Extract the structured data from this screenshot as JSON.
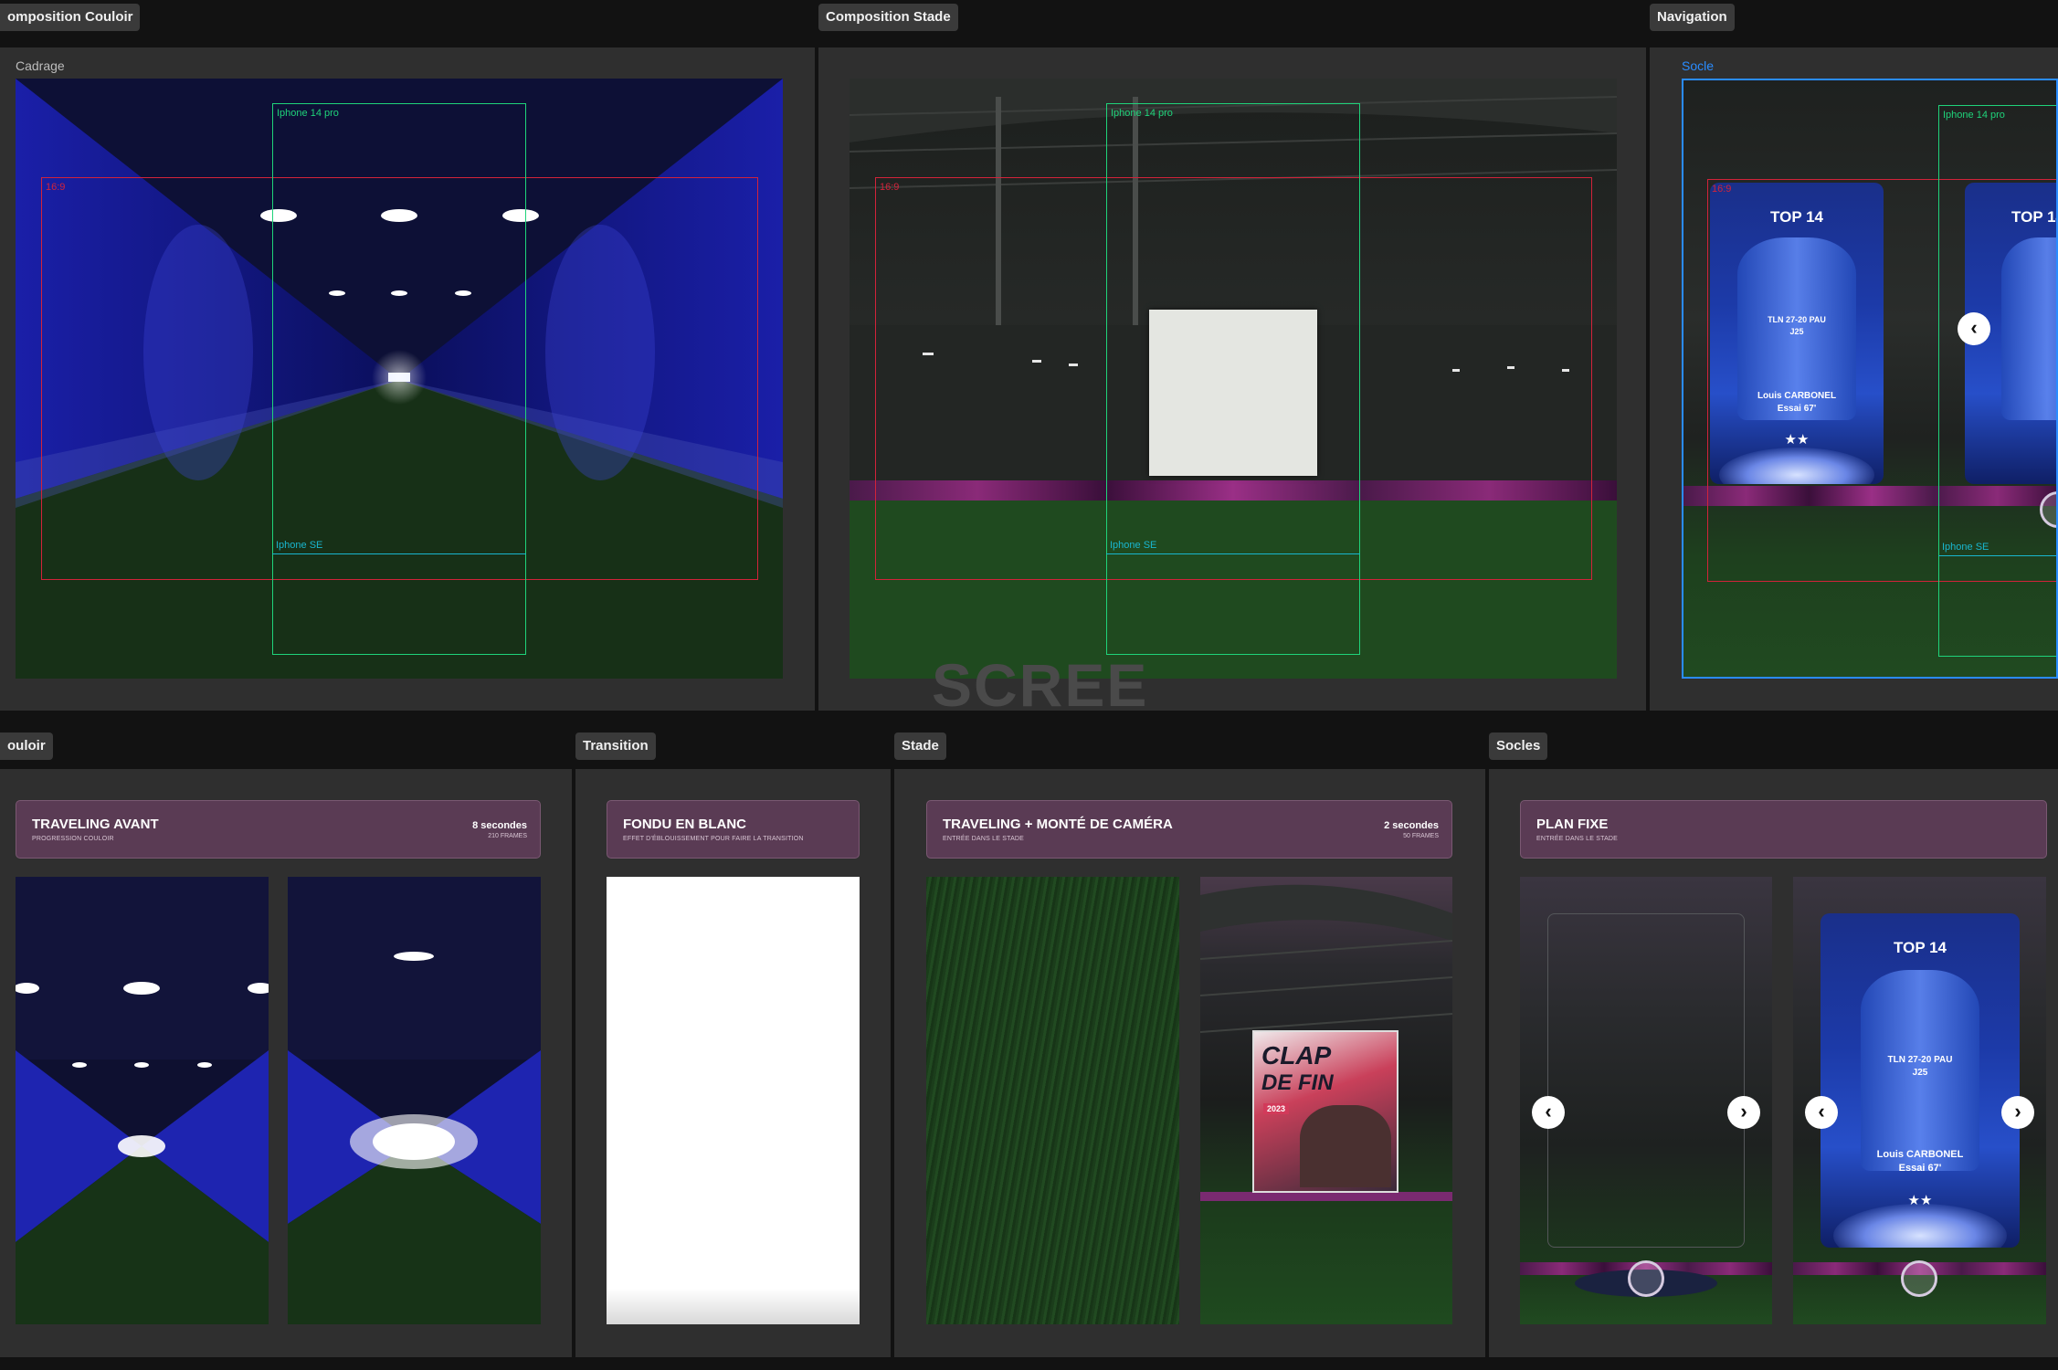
{
  "top_sections": [
    {
      "tag": "omposition Couloir",
      "frame_label": "Cadrage"
    },
    {
      "tag": "Composition Stade",
      "frame_label": ""
    },
    {
      "tag": "Navigation",
      "frame_label": "Socle"
    }
  ],
  "guides": {
    "ratio": "16:9",
    "iphone14": "Iphone 14 pro",
    "iphonese": "Iphone SE"
  },
  "watermark": "SCREE",
  "bottom_sections": [
    {
      "tag": "ouloir"
    },
    {
      "tag": "Transition"
    },
    {
      "tag": "Stade"
    },
    {
      "tag": "Socles"
    }
  ],
  "cards": [
    {
      "title": "TRAVELING AVANT",
      "subtitle": "PROGRESSION COULOIR",
      "duration": "8 secondes",
      "frames": "210 FRAMES"
    },
    {
      "title": "FONDU EN BLANC",
      "subtitle": "EFFET D'ÉBLOUISSEMENT POUR FAIRE LA TRANSITION",
      "duration": "",
      "frames": ""
    },
    {
      "title": "TRAVELING + MONTÉ DE CAMÉRA",
      "subtitle": "ENTRÉE DANS LE STADE",
      "duration": "2 secondes",
      "frames": "50 FRAMES"
    },
    {
      "title": "PLAN FIXE",
      "subtitle": "ENTRÉE DANS LE STADE",
      "duration": "",
      "frames": ""
    }
  ],
  "trophy": {
    "title": "TOP 14",
    "match": "TLN 27-20 PAU",
    "round": "J25",
    "player": "Louis CARBONEL",
    "action": "Essai 67'",
    "stars": "★★"
  },
  "poster": {
    "line1": "CLAP",
    "line2": "DE FIN",
    "year": "2023"
  },
  "nav": {
    "prev": "‹",
    "next": "›"
  },
  "colors": {
    "accent_selection": "#2a8cff",
    "card_bg": "#5a3b54",
    "guide_red": "#d2233a",
    "guide_green": "#1fd37a",
    "guide_cyan": "#19b6cf"
  }
}
